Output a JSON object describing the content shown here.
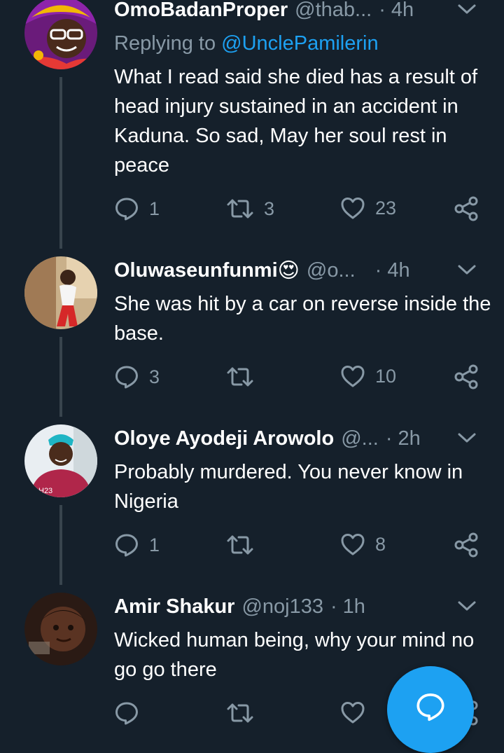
{
  "tweets": [
    {
      "name": "OmoBadanProper",
      "handle": "@thab...",
      "dot": "·",
      "time": "4h",
      "reply_prefix": "Replying to",
      "reply_mention": "@UnclePamilerin",
      "text": "What I read said she died has a result of head injury sustained in an accident in Kaduna. So sad, May her soul rest in peace",
      "replies": "1",
      "retweets": "3",
      "likes": "23"
    },
    {
      "name": "Oluwaseunfunmi",
      "emoji": "😍",
      "handle": "@o...",
      "dot": "·",
      "time": "4h",
      "text": "She was hit by a car on reverse inside the base.",
      "replies": "3",
      "retweets": "",
      "likes": "10"
    },
    {
      "name": "Oloye Ayodeji Arowolo",
      "handle": "@...",
      "dot": "·",
      "time": "2h",
      "text": "Probably murdered. You never know in Nigeria",
      "replies": "1",
      "retweets": "",
      "likes": "8"
    },
    {
      "name": "Amir Shakur",
      "handle": "@noj133",
      "dot": "·",
      "time": "1h",
      "text": "Wicked human being, why your mind no go go there",
      "replies": "",
      "retweets": "",
      "likes": ""
    }
  ],
  "colors": {
    "background": "#15202b",
    "secondary_text": "#8899a6",
    "accent": "#1da1f2",
    "divider": "#38444d"
  },
  "icons": [
    "chevron-down-icon",
    "reply-icon",
    "retweet-icon",
    "like-icon",
    "share-icon",
    "compose-reply-icon"
  ]
}
